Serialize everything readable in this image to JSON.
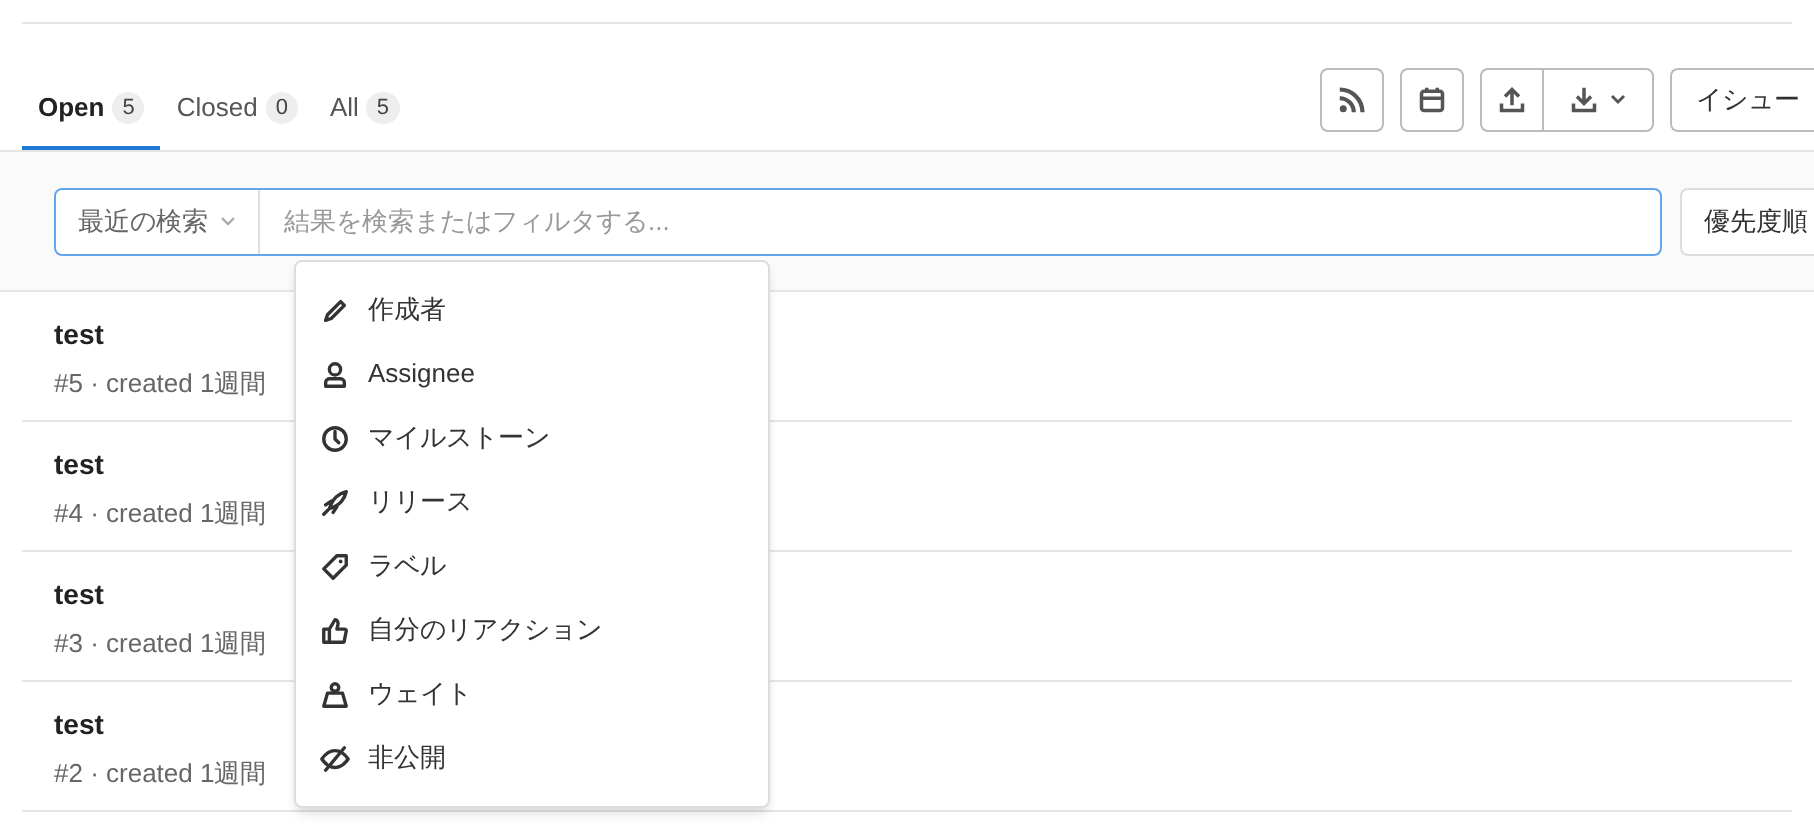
{
  "tabs": [
    {
      "label": "Open",
      "count": "5",
      "selected": true
    },
    {
      "label": "Closed",
      "count": "0",
      "selected": false
    },
    {
      "label": "All",
      "count": "5",
      "selected": false
    }
  ],
  "toolbar": {
    "new_issue_button": "イシュー"
  },
  "filter_bar": {
    "recent_searches": "最近の検索",
    "search": {
      "placeholder": "結果を検索またはフィルタする..."
    },
    "sort_button": "優先度順"
  },
  "issues": [
    {
      "title": "test",
      "meta": "#5 · created 1週間"
    },
    {
      "title": "test",
      "meta": "#4 · created 1週間"
    },
    {
      "title": "test",
      "meta": "#3 · created 1週間"
    },
    {
      "title": "test",
      "meta": "#2 · created 1週間"
    }
  ],
  "filter_dropdown": [
    {
      "kind": "pencil",
      "label": "作成者"
    },
    {
      "kind": "user",
      "label": "Assignee"
    },
    {
      "kind": "clock",
      "label": "マイルストーン"
    },
    {
      "kind": "rocket",
      "label": "リリース"
    },
    {
      "kind": "tag",
      "label": "ラベル"
    },
    {
      "kind": "thumb",
      "label": "自分のリアクション"
    },
    {
      "kind": "weight",
      "label": "ウェイト"
    },
    {
      "kind": "eye",
      "label": "非公開"
    }
  ]
}
